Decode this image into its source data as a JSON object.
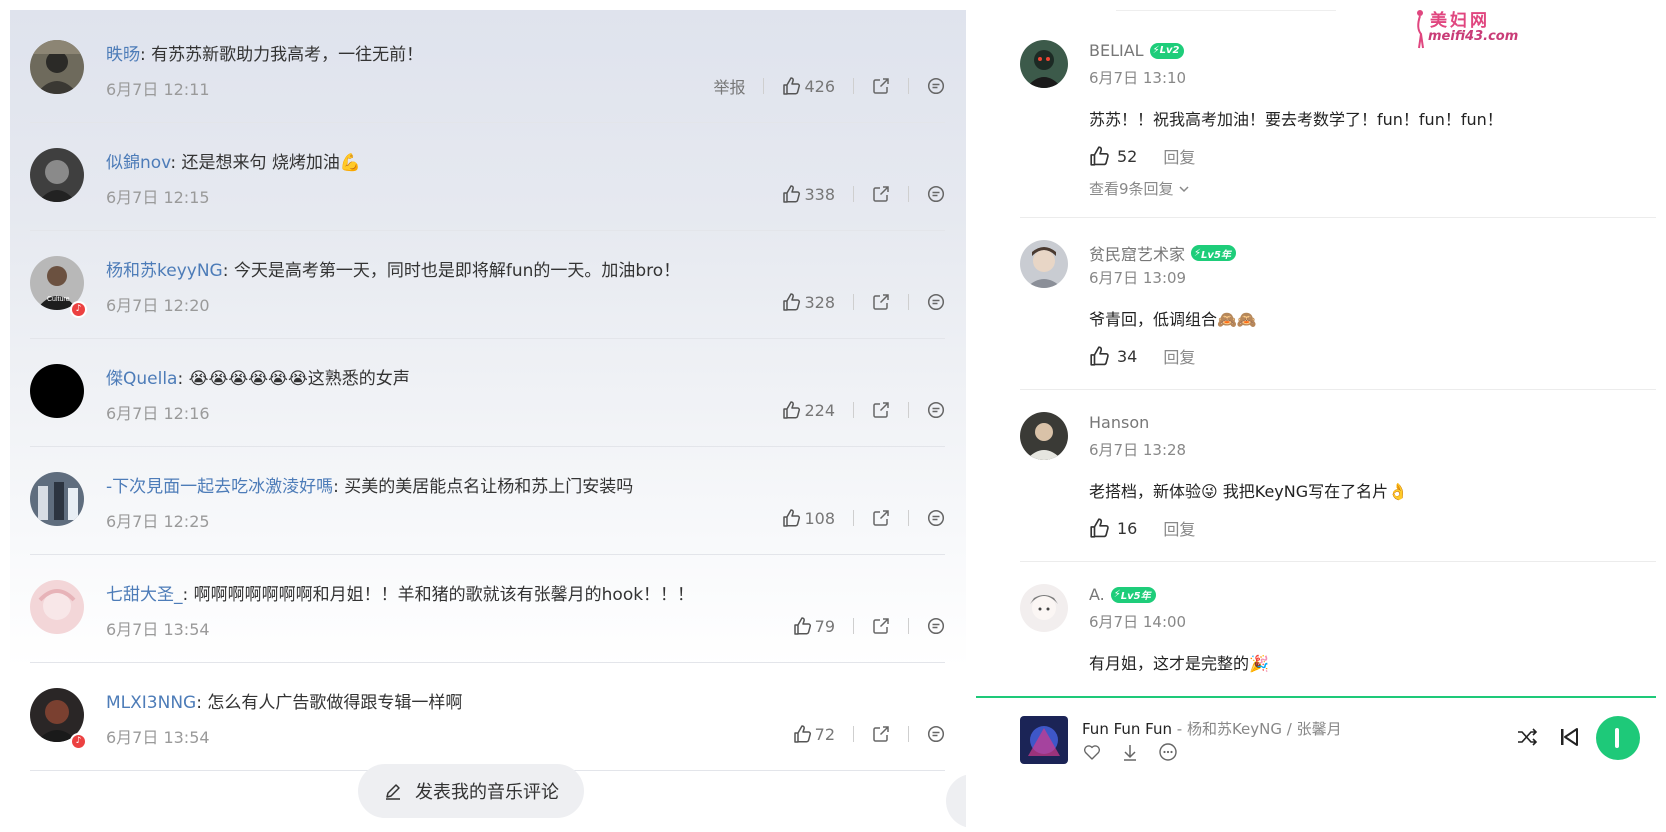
{
  "left_panel": {
    "comments": [
      {
        "name": "昳旸",
        "text": "有苏苏新歌助力我高考，一往无前！",
        "date": "6月7日 12:11",
        "likes": "426",
        "report": "举报",
        "has_badge": false
      },
      {
        "name": "似錦nov",
        "text": "还是想来句 烧烤加油💪",
        "date": "6月7日 12:15",
        "likes": "338",
        "has_badge": false
      },
      {
        "name": "杨和苏keyyNG",
        "text": "今天是高考第一天，同时也是即将解fun的一天。加油bro！",
        "date": "6月7日 12:20",
        "likes": "328",
        "has_badge": true
      },
      {
        "name": "傑Quella",
        "text": "😭😭😭😭😭😭这熟悉的女声",
        "date": "6月7日 12:16",
        "likes": "224",
        "has_badge": false
      },
      {
        "name": "-下次見面一起去吃冰激淩好嗎",
        "text": "买美的美居能点名让杨和苏上门安装吗",
        "date": "6月7日 12:25",
        "likes": "108",
        "has_badge": false
      },
      {
        "name": "七甜大圣_",
        "text": "啊啊啊啊啊啊啊和月姐！！羊和猪的歌就该有张馨月的hook！！！",
        "date": "6月7日 13:54",
        "likes": "79",
        "has_badge": false
      },
      {
        "name": "MLXI3NNG",
        "text": "怎么有人广告歌做得跟专辑一样啊",
        "date": "6月7日 13:54",
        "likes": "72",
        "has_badge": true
      }
    ],
    "compose_label": "发表我的音乐评论"
  },
  "right_panel": {
    "comments": [
      {
        "name": "BELIAL",
        "level": "Lv2",
        "date": "6月7日 13:10",
        "text": "苏苏！！祝我高考加油！要去考数学了！fun！fun！fun！",
        "likes": "52",
        "reply": "回复",
        "more": "查看9条回复"
      },
      {
        "name": "贫民窟艺术家",
        "level": "Lv5年",
        "date": "6月7日 13:09",
        "text": "爷青回，低调组合🙈🙈",
        "likes": "34",
        "reply": "回复"
      },
      {
        "name": "Hanson",
        "level": "",
        "date": "6月7日 13:28",
        "text": "老搭档，新体验😜 我把KeyNG写在了名片👌",
        "likes": "16",
        "reply": "回复"
      },
      {
        "name": "A.",
        "level": "Lv5年",
        "date": "6月7日 14:00",
        "text": "有月姐，这才是完整的🎉"
      }
    ],
    "player": {
      "song": "Fun Fun Fun",
      "artists": " - 杨和苏KeyNG / 张馨月"
    }
  },
  "watermark": {
    "line1": "美妇网",
    "line2": "meifi43.com"
  },
  "colors": {
    "accent": "#1ec979",
    "name_blue": "#4d7cb8",
    "badge_red": "#ec4141"
  }
}
